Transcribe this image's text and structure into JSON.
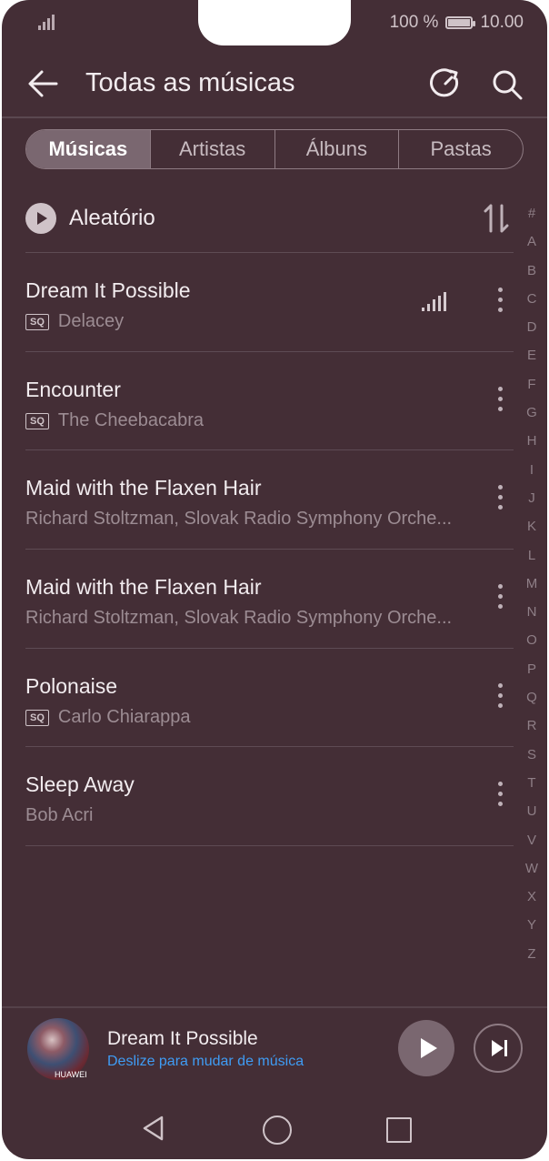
{
  "status": {
    "battery": "100 %",
    "time": "10.00"
  },
  "header": {
    "title": "Todas as músicas"
  },
  "tabs": [
    {
      "label": "Músicas"
    },
    {
      "label": "Artistas"
    },
    {
      "label": "Álbuns"
    },
    {
      "label": "Pastas"
    }
  ],
  "shuffle": {
    "label": "Aleatório"
  },
  "songs": [
    {
      "title": "Dream It Possible",
      "sq": "SQ",
      "artist": "Delacey"
    },
    {
      "title": "Encounter",
      "sq": "SQ",
      "artist": "The Cheebacabra"
    },
    {
      "title": "Maid with the Flaxen Hair",
      "sq": "",
      "artist": "Richard Stoltzman, Slovak Radio Symphony Orche..."
    },
    {
      "title": "Maid with the Flaxen Hair",
      "sq": "",
      "artist": "Richard Stoltzman, Slovak Radio Symphony Orche..."
    },
    {
      "title": "Polonaise",
      "sq": "SQ",
      "artist": "Carlo Chiarappa"
    },
    {
      "title": "Sleep Away",
      "sq": "",
      "artist": "Bob Acri"
    }
  ],
  "alphabet": [
    "#",
    "A",
    "B",
    "C",
    "D",
    "E",
    "F",
    "G",
    "H",
    "I",
    "J",
    "K",
    "L",
    "M",
    "N",
    "O",
    "P",
    "Q",
    "R",
    "S",
    "T",
    "U",
    "V",
    "W",
    "X",
    "Y",
    "Z"
  ],
  "now_playing": {
    "title": "Dream It Possible",
    "subtitle": "Deslize para mudar de música",
    "cover_logo": "HUAWEI"
  }
}
